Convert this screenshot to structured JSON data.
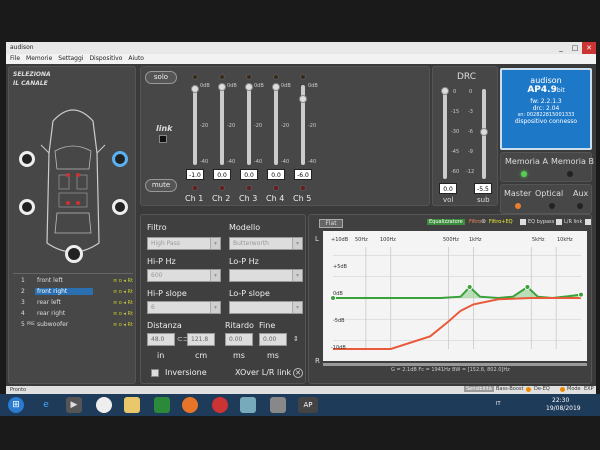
{
  "window": {
    "title": "audison",
    "controls": [
      "_",
      "□",
      "✕"
    ]
  },
  "menu": [
    "File",
    "Memorie",
    "Settaggi",
    "Dispositivo",
    "Aiuto"
  ],
  "selector": {
    "title_line1": "SELEZIONA",
    "title_line2": "IL CANALE"
  },
  "channels": [
    {
      "n": "1",
      "label": "front left",
      "tag": "≡ o ◂ Rt"
    },
    {
      "n": "2",
      "label": "front right",
      "tag": "≡ o ◂ Rt",
      "selected": true
    },
    {
      "n": "3",
      "label": "rear left",
      "tag": "≡ o ◂ Rt"
    },
    {
      "n": "4",
      "label": "rear right",
      "tag": "≡ o ◂ Rt"
    },
    {
      "n": "5",
      "label": "subwoofer",
      "tag": "≡ o ◂ Rt",
      "pre": "PRE"
    }
  ],
  "mixer": {
    "solo": "solo",
    "mute": "mute",
    "link": "link",
    "scale": [
      "0dB",
      "-20",
      "-40"
    ],
    "faders": [
      {
        "name": "Ch 1",
        "value": "-1.0",
        "level": 0.03
      },
      {
        "name": "Ch 2",
        "value": "0.0",
        "level": 0
      },
      {
        "name": "Ch 3",
        "value": "0.0",
        "level": 0
      },
      {
        "name": "Ch 4",
        "value": "0.0",
        "level": 0
      },
      {
        "name": "Ch 5",
        "value": "-6.0",
        "level": 0.15
      }
    ]
  },
  "drc": {
    "title": "DRC",
    "vol_scale": [
      "0",
      "-15",
      "-30",
      "-45",
      "-60"
    ],
    "sub_scale": [
      "0",
      "-3",
      "-6",
      "-9",
      "-12"
    ],
    "vol": "0.0",
    "sub": "-5.5",
    "vol_label": "vol",
    "sub_label": "sub",
    "vol_level": 0,
    "sub_level": 0.46
  },
  "device": {
    "brand": "audison",
    "model": "AP4.9",
    "model_suffix": "bit",
    "fw": "fw: 2.2.1.3",
    "drc": "drc: 2.04",
    "sn": "sn: 002822815001333",
    "status": "dispositivo connesso"
  },
  "memory": {
    "a": "Memoria A",
    "b": "Memoria B"
  },
  "sources": {
    "master": "Master",
    "optical": "Optical",
    "aux": "Aux"
  },
  "filter": {
    "filtro": "Filtro",
    "filtro_value": "High Pass",
    "modello": "Modello",
    "modello_value": "Butterworth",
    "hip_hz": "Hi-P Hz",
    "hip_hz_value": "600",
    "lop_hz": "Lo-P Hz",
    "hip_slope": "Hi-P slope",
    "hip_slope_value": "6",
    "lop_slope": "Lo-P slope",
    "distanza": "Distanza",
    "dist_in": "48.0",
    "dist_cm": "121.8",
    "unit_in": "in",
    "unit_cm": "cm",
    "ritardo": "Ritardo",
    "ritardo_value": "0.00",
    "ritardo_unit": "ms",
    "fine": "Fine",
    "fine_value": "0.00",
    "fine_unit": "ms",
    "inversione": "Inversione",
    "xover": "XOver L/R link"
  },
  "eq": {
    "flat": "Flat",
    "equalizzatore": "Equalizzatore",
    "filtro": "Filtro",
    "filtro_eq": "Filtro+EQ",
    "bypass": "EQ bypass",
    "lr_link": "L/R link",
    "db_labels": [
      "+10dB",
      "+5dB",
      "0dB",
      "-5dB",
      "-10dB"
    ],
    "freq_labels": [
      "50Hz",
      "100Hz",
      "500Hz",
      "1kHz",
      "5kHz",
      "10kHz"
    ],
    "readout": "G = 2.1dB     Fc = 1941Hz     BW = [152.8, 802.0]Hz",
    "bottom_l": "L",
    "bottom_r": "R"
  },
  "footer": {
    "status": "Pronto",
    "sensibility": "Sensibilità",
    "bass_boost": "Bass-Boost",
    "de_eq": "De-EQ",
    "mode": "Mode",
    "exp": "EXP"
  },
  "taskbar": {
    "lang": "IT",
    "time": "22:30",
    "date": "19/08/2019",
    "app": "AP"
  },
  "chart_data": {
    "type": "line",
    "x_scale": "log",
    "y_range": [
      -12,
      12
    ],
    "series": [
      {
        "values": [
          [
            20,
            0
          ],
          [
            400,
            0
          ],
          [
            700,
            0.3
          ],
          [
            900,
            2.6
          ],
          [
            1200,
            0.3
          ],
          [
            2000,
            0
          ],
          [
            3000,
            0.3
          ],
          [
            4500,
            2.6
          ],
          [
            6000,
            0.3
          ],
          [
            9000,
            0
          ],
          [
            14000,
            0.4
          ],
          [
            20000,
            0.8
          ]
        ]
      },
      {
        "values": [
          [
            20,
            -12
          ],
          [
            100,
            -12
          ],
          [
            300,
            -9
          ],
          [
            500,
            -5.5
          ],
          [
            700,
            -3
          ],
          [
            1000,
            -1.5
          ],
          [
            2000,
            -0.3
          ],
          [
            5000,
            0
          ],
          [
            20000,
            0
          ]
        ]
      }
    ]
  }
}
